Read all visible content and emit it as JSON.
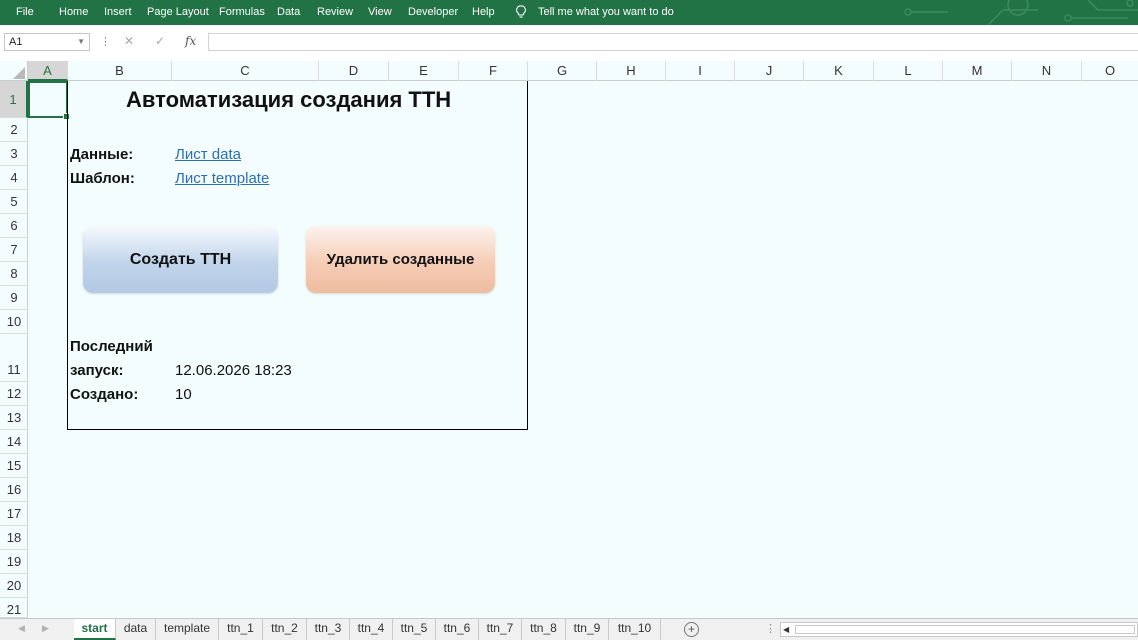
{
  "ribbon": {
    "tabs": [
      "File",
      "Home",
      "Insert",
      "Page Layout",
      "Formulas",
      "Data",
      "Review",
      "View",
      "Developer",
      "Help"
    ],
    "tell_me": "Tell me what you want to do"
  },
  "formula_bar": {
    "name_box": "A1",
    "fx": "fx",
    "formula": ""
  },
  "columns": [
    "A",
    "B",
    "C",
    "D",
    "E",
    "F",
    "G",
    "H",
    "I",
    "J",
    "K",
    "L",
    "M",
    "N",
    "O"
  ],
  "rows": [
    "1",
    "2",
    "3",
    "4",
    "5",
    "6",
    "7",
    "8",
    "9",
    "10",
    "11",
    "12",
    "13",
    "14",
    "15",
    "16",
    "17",
    "18",
    "19",
    "20",
    "21"
  ],
  "selected_cell": "A1",
  "sheet": {
    "title": "Автоматизация создания ТТН",
    "data_label": "Данные:",
    "data_link": "Лист data",
    "template_label": "Шаблон:",
    "template_link": "Лист template",
    "create_button": "Создать ТТН",
    "delete_button": "Удалить созданные",
    "last_run_label_1": "Последний",
    "last_run_label_2": "запуск:",
    "last_run_value": "12.06.2026 18:23",
    "created_label": "Создано:",
    "created_value": "10"
  },
  "sheet_tabs": [
    "start",
    "data",
    "template",
    "ttn_1",
    "ttn_2",
    "ttn_3",
    "ttn_4",
    "ttn_5",
    "ttn_6",
    "ttn_7",
    "ttn_8",
    "ttn_9",
    "ttn_10"
  ],
  "active_sheet": "start",
  "colors": {
    "excel_green": "#217346",
    "grid_bg": "#f4fdfd",
    "link": "#2e6fb0"
  }
}
